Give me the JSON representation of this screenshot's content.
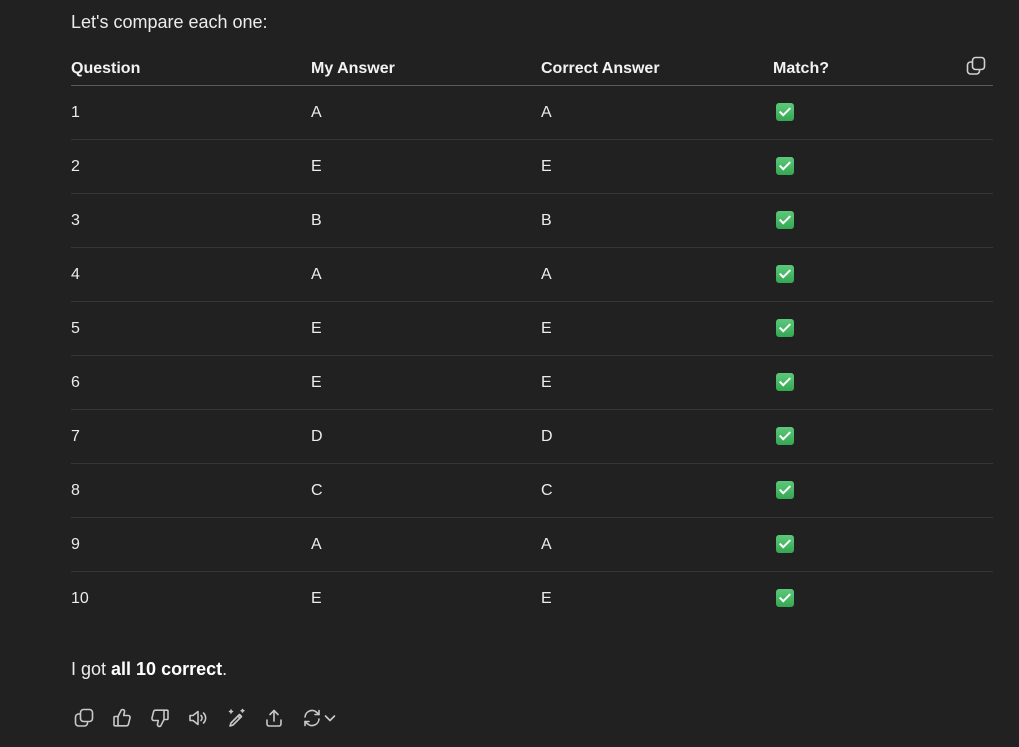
{
  "intro_text": "Let's compare each one:",
  "table": {
    "headers": [
      "Question",
      "My Answer",
      "Correct Answer",
      "Match?"
    ],
    "rows": [
      {
        "question": "1",
        "my_answer": "A",
        "correct_answer": "A",
        "match": true
      },
      {
        "question": "2",
        "my_answer": "E",
        "correct_answer": "E",
        "match": true
      },
      {
        "question": "3",
        "my_answer": "B",
        "correct_answer": "B",
        "match": true
      },
      {
        "question": "4",
        "my_answer": "A",
        "correct_answer": "A",
        "match": true
      },
      {
        "question": "5",
        "my_answer": "E",
        "correct_answer": "E",
        "match": true
      },
      {
        "question": "6",
        "my_answer": "E",
        "correct_answer": "E",
        "match": true
      },
      {
        "question": "7",
        "my_answer": "D",
        "correct_answer": "D",
        "match": true
      },
      {
        "question": "8",
        "my_answer": "C",
        "correct_answer": "C",
        "match": true
      },
      {
        "question": "9",
        "my_answer": "A",
        "correct_answer": "A",
        "match": true
      },
      {
        "question": "10",
        "my_answer": "E",
        "correct_answer": "E",
        "match": true
      }
    ],
    "copy_icon": "copy-icon",
    "match_icon": "check-mark-button-emoji"
  },
  "summary": {
    "prefix": "I got ",
    "bold": "all 10 correct",
    "suffix": "."
  },
  "actions": [
    {
      "name": "copy-button",
      "icon": "copy-icon"
    },
    {
      "name": "thumbs-up-button",
      "icon": "thumbs-up-icon"
    },
    {
      "name": "thumbs-down-button",
      "icon": "thumbs-down-icon"
    },
    {
      "name": "read-aloud-button",
      "icon": "speaker-icon"
    },
    {
      "name": "edit-button",
      "icon": "pen-sparkle-icon"
    },
    {
      "name": "share-button",
      "icon": "upload-icon"
    },
    {
      "name": "regenerate-button",
      "icon": "refresh-icon"
    }
  ],
  "colors": {
    "background": "#212121",
    "text": "#ececec",
    "check": "#3fb950",
    "divider": "#363636"
  }
}
